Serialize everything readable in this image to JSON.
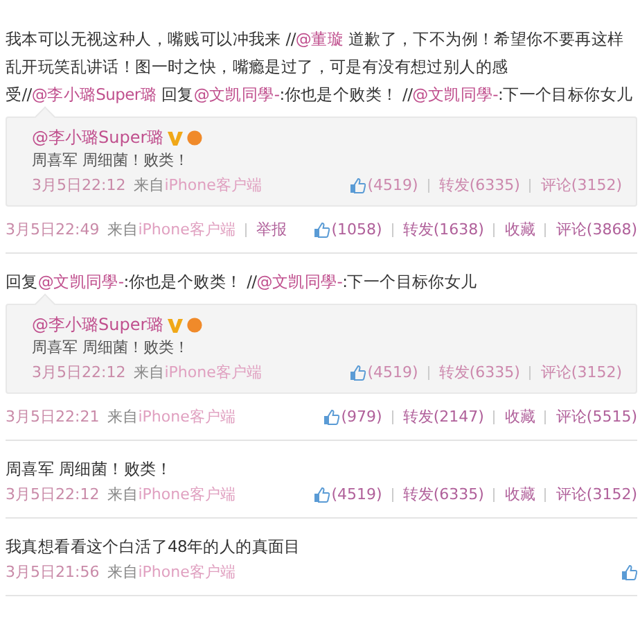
{
  "posts": [
    {
      "text": [
        {
          "kind": "plain",
          "text": "我本可以无视这种人，嘴贱可以冲我来 //"
        },
        {
          "kind": "mention",
          "text": "@董璇"
        },
        {
          "kind": "plain",
          "text": " 道歉了，下不为例！希望你不要再这样乱开玩笑乱讲话！图一时之快，嘴瘾是过了，可是有没有想过别人的感受//"
        },
        {
          "kind": "mention",
          "text": "@李小璐Super璐"
        },
        {
          "kind": "plain",
          "text": " 回复"
        },
        {
          "kind": "mention",
          "text": "@文凯同學-"
        },
        {
          "kind": "plain",
          "text": ":你也是个败类！ //"
        },
        {
          "kind": "mention",
          "text": "@文凯同學-"
        },
        {
          "kind": "plain",
          "text": ":下一个目标你女儿"
        }
      ],
      "repost": {
        "author": "@李小璐Super璐",
        "verified": true,
        "text": "周喜军 周细菌！败类！",
        "time": "3月5日22:12",
        "via": "来自",
        "source": "iPhone客户端",
        "stats": [
          {
            "kind": "like",
            "text": "(4519)"
          },
          {
            "kind": "forward",
            "text": "转发(6335)"
          },
          {
            "kind": "comment",
            "text": "评论(3152)"
          }
        ]
      },
      "time": "3月5日22:49",
      "via": "来自",
      "source": "iPhone客户端",
      "report": "举报",
      "stats": [
        {
          "kind": "like",
          "text": "(1058)"
        },
        {
          "kind": "forward",
          "text": "转发(1638)"
        },
        {
          "kind": "favorite",
          "text": "收藏"
        },
        {
          "kind": "comment",
          "text": "评论(3868)"
        }
      ]
    },
    {
      "text": [
        {
          "kind": "plain",
          "text": "回复"
        },
        {
          "kind": "mention",
          "text": "@文凯同學-"
        },
        {
          "kind": "plain",
          "text": ":你也是个败类！ //"
        },
        {
          "kind": "mention",
          "text": "@文凯同學-"
        },
        {
          "kind": "plain",
          "text": ":下一个目标你女儿"
        }
      ],
      "repost": {
        "author": "@李小璐Super璐",
        "verified": true,
        "text": "周喜军 周细菌！败类！",
        "time": "3月5日22:12",
        "via": "来自",
        "source": "iPhone客户端",
        "stats": [
          {
            "kind": "like",
            "text": "(4519)"
          },
          {
            "kind": "forward",
            "text": "转发(6335)"
          },
          {
            "kind": "comment",
            "text": "评论(3152)"
          }
        ]
      },
      "time": "3月5日22:21",
      "via": "来自",
      "source": "iPhone客户端",
      "stats": [
        {
          "kind": "like",
          "text": "(979)"
        },
        {
          "kind": "forward",
          "text": "转发(2147)"
        },
        {
          "kind": "favorite",
          "text": "收藏"
        },
        {
          "kind": "comment",
          "text": "评论(5515)"
        }
      ]
    },
    {
      "text": [
        {
          "kind": "plain",
          "text": "周喜军 周细菌！败类！"
        }
      ],
      "time": "3月5日22:12",
      "via": "来自",
      "source": "iPhone客户端",
      "stats": [
        {
          "kind": "like",
          "text": "(4519)"
        },
        {
          "kind": "forward",
          "text": "转发(6335)"
        },
        {
          "kind": "favorite",
          "text": "收藏"
        },
        {
          "kind": "comment",
          "text": "评论(3152)"
        }
      ]
    },
    {
      "text": [
        {
          "kind": "plain",
          "text": "我真想看看这个白活了48年的人的真面目"
        }
      ],
      "time": "3月5日21:56",
      "via": "来自",
      "source": "iPhone客户端",
      "stats": [
        {
          "kind": "like"
        }
      ]
    }
  ]
}
